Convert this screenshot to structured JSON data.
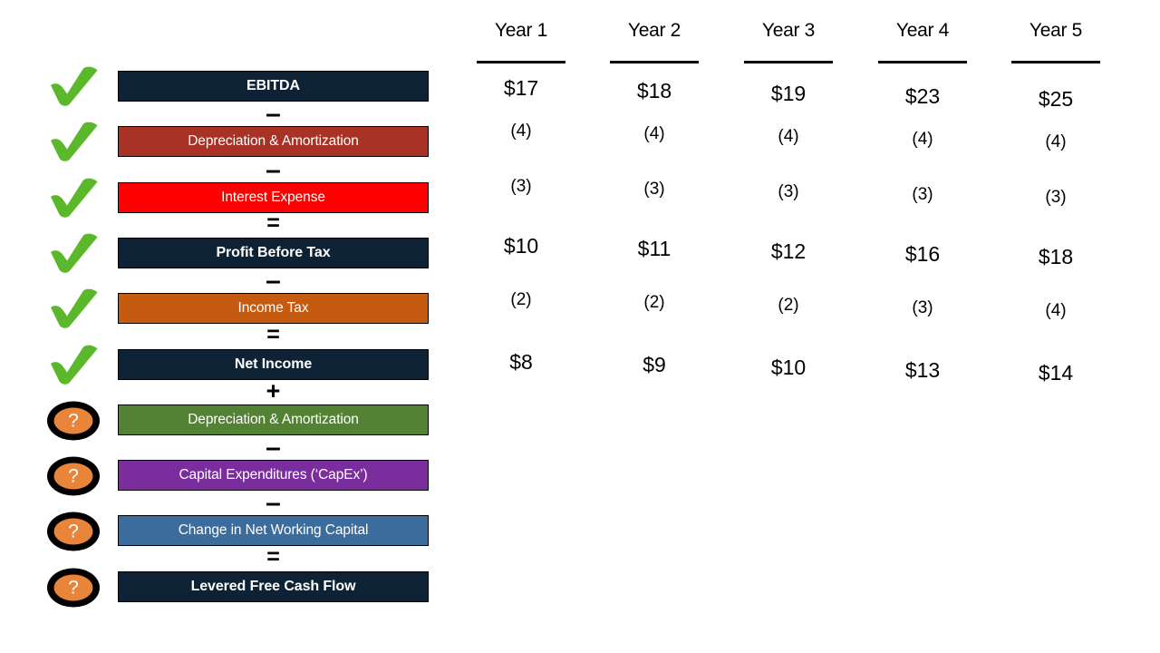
{
  "diagram": {
    "title": "Levered Free Cash Flow build-up",
    "status_icons": {
      "known": "check-icon",
      "unknown": "question-mark-icon"
    },
    "colors": {
      "navy": "#0d2235",
      "dark_red": "#a93226",
      "bright_red": "#ff0000",
      "orange": "#c55a11",
      "green": "#548235",
      "purple": "#7b2d9e",
      "blue": "#3b6c9c",
      "check_green": "#5cb82b",
      "badge_orange": "#e8853b",
      "badge_ring": "#000000",
      "text_white": "#ffffff",
      "text_black": "#000000"
    },
    "rows": [
      {
        "label": "EBITDA",
        "color_key": "navy",
        "status": "check",
        "bold": true,
        "operator_above": ""
      },
      {
        "label": "Depreciation & Amortization",
        "color_key": "dark_red",
        "status": "check",
        "bold": false,
        "operator_above": "–"
      },
      {
        "label": "Interest Expense",
        "color_key": "bright_red",
        "status": "check",
        "bold": false,
        "operator_above": "–"
      },
      {
        "label": "Profit Before Tax",
        "color_key": "navy",
        "status": "check",
        "bold": true,
        "operator_above": "="
      },
      {
        "label": "Income Tax",
        "color_key": "orange",
        "status": "check",
        "bold": false,
        "operator_above": "–"
      },
      {
        "label": "Net Income",
        "color_key": "navy",
        "status": "check",
        "bold": true,
        "operator_above": "="
      },
      {
        "label": "Depreciation & Amortization",
        "color_key": "green",
        "status": "question",
        "bold": false,
        "operator_above": "+"
      },
      {
        "label": "Capital Expenditures (‘CapEx’)",
        "color_key": "purple",
        "status": "question",
        "bold": false,
        "operator_above": "–"
      },
      {
        "label": "Change in Net Working Capital",
        "color_key": "blue",
        "status": "question",
        "bold": false,
        "operator_above": "–"
      },
      {
        "label": "Levered Free Cash Flow",
        "color_key": "navy",
        "status": "question",
        "bold": true,
        "operator_above": "="
      }
    ]
  },
  "table": {
    "columns": [
      "Year 1",
      "Year 2",
      "Year 3",
      "Year 4",
      "Year 5"
    ],
    "rows": [
      {
        "name": "EBITDA",
        "size": "major",
        "values": [
          "$17",
          "$18",
          "$19",
          "$23",
          "$25"
        ]
      },
      {
        "name": "Depreciation & Amortization",
        "size": "minor",
        "values": [
          "(4)",
          "(4)",
          "(4)",
          "(4)",
          "(4)"
        ]
      },
      {
        "name": "Interest Expense",
        "size": "minor",
        "values": [
          "(3)",
          "(3)",
          "(3)",
          "(3)",
          "(3)"
        ]
      },
      {
        "name": "Profit Before Tax",
        "size": "major",
        "values": [
          "$10",
          "$11",
          "$12",
          "$16",
          "$18"
        ]
      },
      {
        "name": "Income Tax",
        "size": "minor",
        "values": [
          "(2)",
          "(2)",
          "(2)",
          "(3)",
          "(4)"
        ]
      },
      {
        "name": "Net Income",
        "size": "major",
        "values": [
          "$8",
          "$9",
          "$10",
          "$13",
          "$14"
        ]
      }
    ]
  }
}
